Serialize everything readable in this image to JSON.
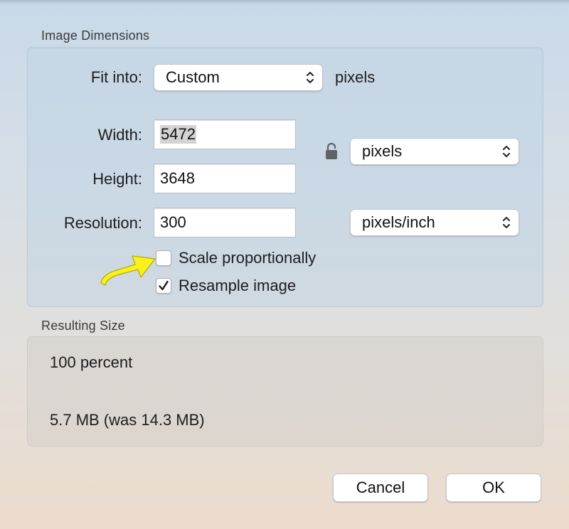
{
  "image_dimensions": {
    "title": "Image Dimensions",
    "fit_into": {
      "label": "Fit into:",
      "value": "Custom",
      "unit": "pixels"
    },
    "width": {
      "label": "Width:",
      "value": "5472"
    },
    "height": {
      "label": "Height:",
      "value": "3648"
    },
    "size_unit": {
      "value": "pixels"
    },
    "resolution": {
      "label": "Resolution:",
      "value": "300",
      "unit": "pixels/inch"
    },
    "scale_proportionally": {
      "label": "Scale proportionally",
      "checked": false
    },
    "resample_image": {
      "label": "Resample image",
      "checked": true
    }
  },
  "resulting_size": {
    "title": "Resulting Size",
    "percent": "100 percent",
    "file_size": "5.7 MB (was 14.3 MB)"
  },
  "buttons": {
    "cancel": "Cancel",
    "ok": "OK"
  },
  "annotation": {
    "arrow_color": "#f7f21e",
    "icon": "yellow-arrow-icon"
  },
  "icons": {
    "lock": "lock-icon",
    "chevron": "up-down-chevron-icon",
    "checkmark": "checkmark-icon"
  }
}
